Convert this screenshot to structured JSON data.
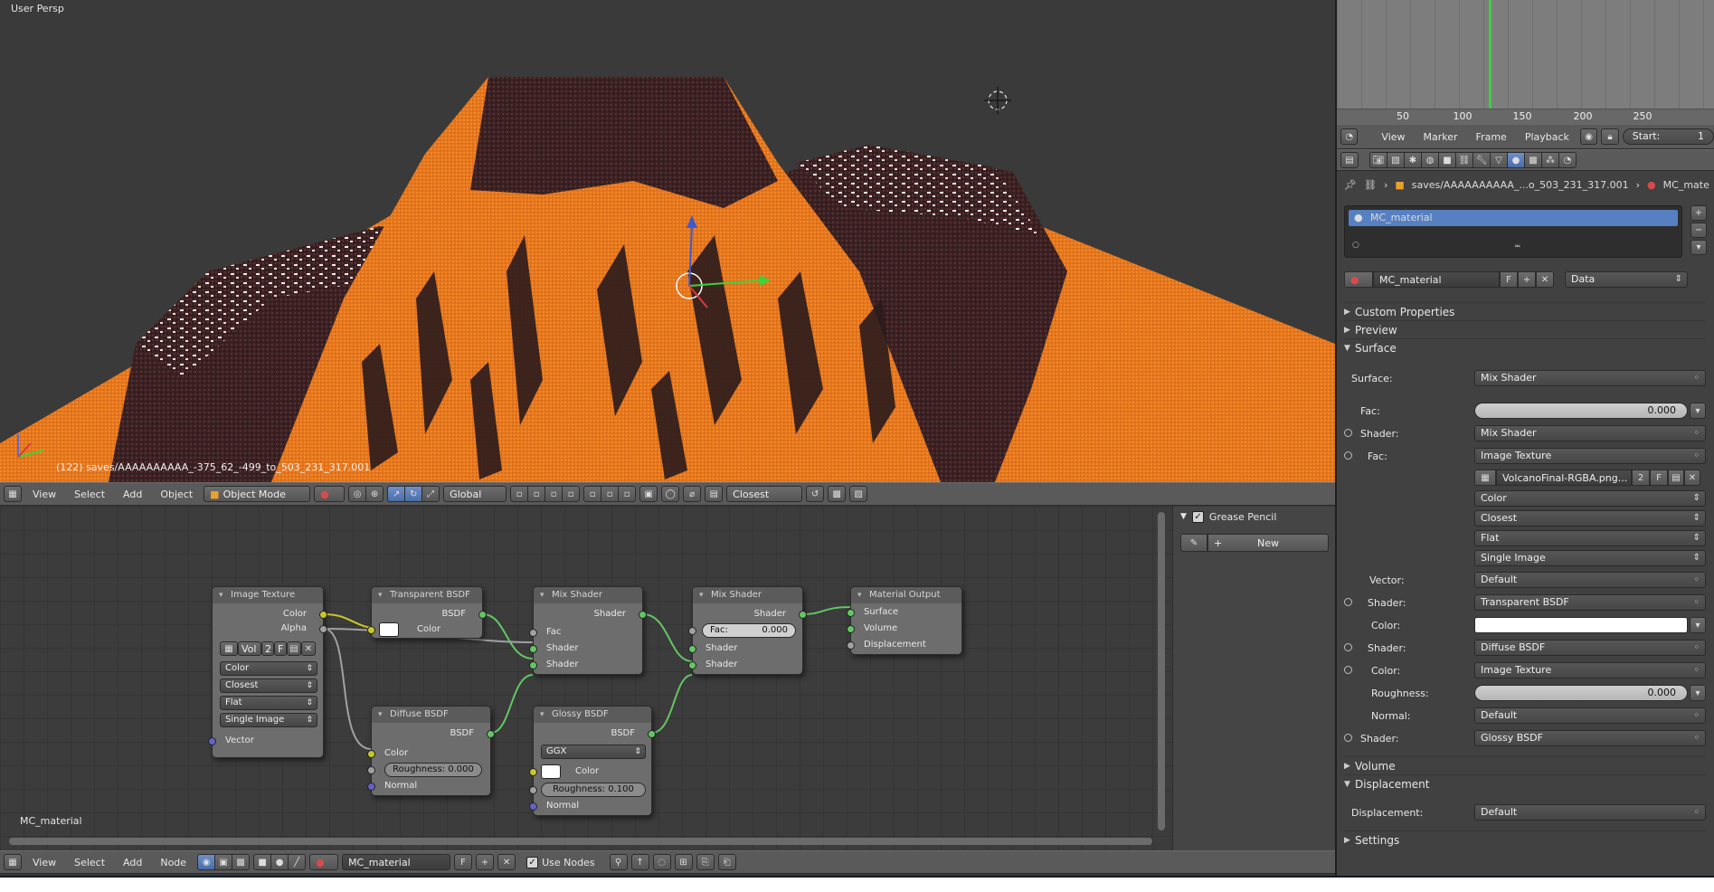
{
  "viewport": {
    "title": "User Persp",
    "info": "(122) saves/AAAAAAAAAA_-375_62_-499_to_503_231_317.001",
    "header": {
      "menus": [
        "View",
        "Select",
        "Add",
        "Object"
      ],
      "mode": "Object Mode",
      "orientation": "Global",
      "snap": "Closest"
    }
  },
  "node_editor": {
    "material_label": "MC_material",
    "nodes": {
      "image_texture": {
        "title": "Image Texture",
        "out_color": "Color",
        "out_alpha": "Alpha",
        "image_name": "Vol",
        "image_users": "2",
        "fake": "F",
        "color_space": "Color",
        "interpolation": "Closest",
        "projection": "Flat",
        "source": "Single Image",
        "in_vector": "Vector"
      },
      "transparent": {
        "title": "Transparent BSDF",
        "out": "BSDF",
        "in_color": "Color"
      },
      "diffuse": {
        "title": "Diffuse BSDF",
        "out": "BSDF",
        "in_color": "Color",
        "roughness": "Roughness: 0.000",
        "in_normal": "Normal"
      },
      "mix1": {
        "title": "Mix Shader",
        "out": "Shader",
        "in_fac": "Fac",
        "in_shader1": "Shader",
        "in_shader2": "Shader"
      },
      "glossy": {
        "title": "Glossy BSDF",
        "out": "BSDF",
        "distribution": "GGX",
        "in_color": "Color",
        "roughness": "Roughness: 0.100",
        "in_normal": "Normal"
      },
      "mix2": {
        "title": "Mix Shader",
        "out": "Shader",
        "fac": "Fac:",
        "fac_value": "0.000",
        "in_shader1": "Shader",
        "in_shader2": "Shader"
      },
      "output": {
        "title": "Material Output",
        "in_surface": "Surface",
        "in_volume": "Volume",
        "in_displacement": "Displacement"
      }
    },
    "header": {
      "menus": [
        "View",
        "Select",
        "Add",
        "Node"
      ],
      "material": "MC_material",
      "fake": "F",
      "use_nodes": "Use Nodes"
    }
  },
  "grease_pencil": {
    "title": "Grease Pencil",
    "new_button": "New"
  },
  "timeline": {
    "ticks": [
      "50",
      "100",
      "150",
      "200",
      "250"
    ],
    "menus": [
      "View",
      "Marker",
      "Frame",
      "Playback"
    ],
    "start_label": "Start:",
    "start_value": "1"
  },
  "properties": {
    "breadcrumb_path": "saves/AAAAAAAAAA_...o_503_231_317.001",
    "breadcrumb_material": "MC_mate",
    "slot_item": "MC_material",
    "material_name": "MC_material",
    "fake": "F",
    "link_mode": "Data",
    "sections": {
      "custom_props": "Custom Properties",
      "preview": "Preview",
      "surface": "Surface",
      "volume": "Volume",
      "displacement": "Displacement",
      "settings": "Settings"
    },
    "surface_rows": {
      "surface_label": "Surface:",
      "surface_value": "Mix Shader",
      "fac_label": "Fac:",
      "fac_value": "0.000",
      "shader_label": "Shader:",
      "shader_value": "Mix Shader",
      "fac2_label": "Fac:",
      "fac2_value": "Image Texture",
      "image_name": "VolcanoFinal-RGBA.png...",
      "image_users": "2",
      "image_fake": "F",
      "color_space": "Color",
      "interpolation": "Closest",
      "projection": "Flat",
      "source": "Single Image",
      "vector_label": "Vector:",
      "vector_value": "Default",
      "shader2_label": "Shader:",
      "shader2_value": "Transparent BSDF",
      "color_label": "Color:",
      "shader3_label": "Shader:",
      "shader3_value": "Diffuse BSDF",
      "color2_label": "Color:",
      "color2_value": "Image Texture",
      "roughness_label": "Roughness:",
      "roughness_value": "0.000",
      "normal_label": "Normal:",
      "normal_value": "Default",
      "shader4_label": "Shader:",
      "shader4_value": "Glossy BSDF"
    },
    "displacement_label": "Displacement:",
    "displacement_value": "Default"
  },
  "colors": {
    "terrain_orange": "#e8791f",
    "rock_dark": "#2a1b1d",
    "selection_blue": "#5680c2",
    "timeline_playhead": "#3fce3f"
  }
}
